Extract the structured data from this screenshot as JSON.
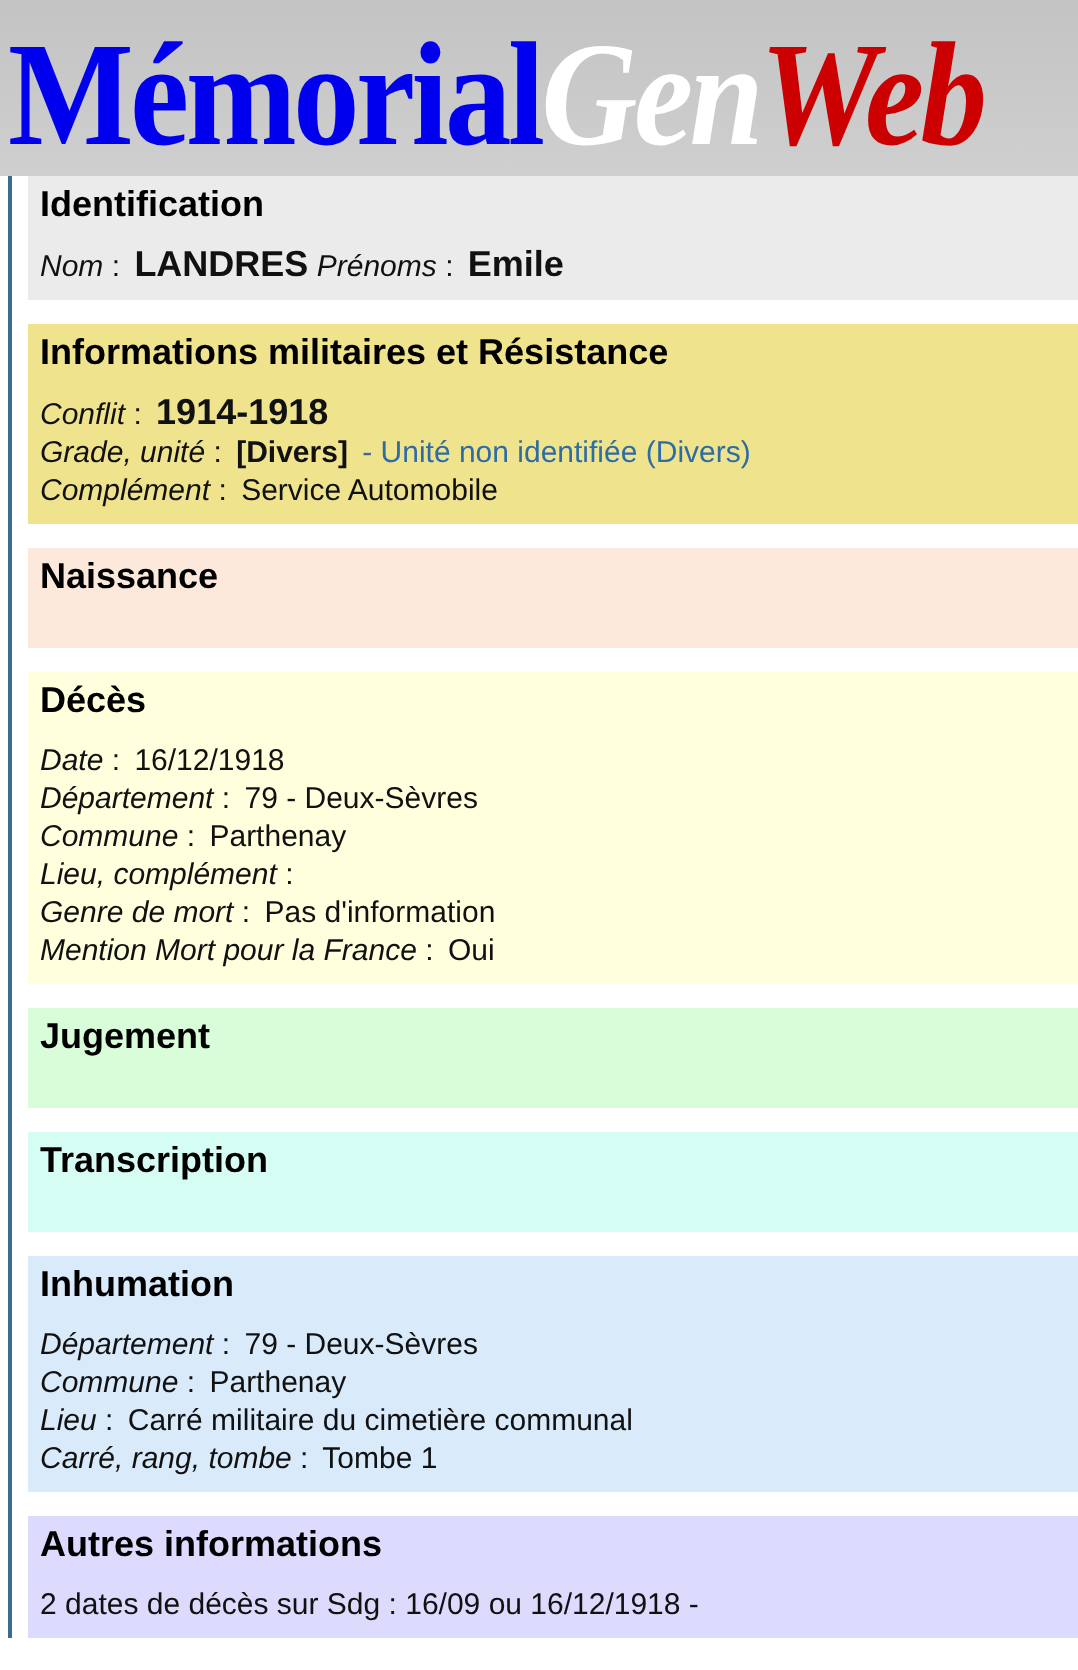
{
  "logo": {
    "parts": [
      {
        "text": "Mémorial",
        "kind": "main"
      },
      {
        "text": "Gen",
        "kind": "light"
      },
      {
        "text": "Web",
        "kind": "accent"
      }
    ]
  },
  "sections": [
    {
      "title": "Identification",
      "color": "#ebebeb",
      "lines": [
        {
          "pairs": [
            {
              "label": "*Nom* :",
              "value": "LANDRES",
              "kind": "large"
            },
            {
              "label": "*Prénoms* :",
              "value": "Emile",
              "kind": "large"
            }
          ]
        }
      ]
    },
    {
      "title": "Informations militaires et Résistance",
      "color": "#efe38d",
      "lines": [
        {
          "pairs": [
            {
              "label": "*Conflit* :",
              "value": "1914-1918",
              "kind": "large"
            }
          ]
        },
        {
          "pairs": [
            {
              "label": "*Grade, unité* :",
              "value": "[Divers]",
              "kind": "bold",
              "link": "- Unité non identifiée (Divers)"
            }
          ]
        },
        {
          "pairs": [
            {
              "label": "*Complément* :",
              "value": "Service Automobile",
              "kind": "plain"
            }
          ]
        }
      ]
    },
    {
      "title": "Naissance",
      "color": "#fde8dc"
    },
    {
      "title": "Décès",
      "color": "#ffffdd",
      "lines": [
        {
          "pairs": [
            {
              "label": "*Date* :",
              "value": "16/12/1918",
              "kind": "plain"
            }
          ]
        },
        {
          "pairs": [
            {
              "label": "*Département* :",
              "value": "79 - Deux-Sèvres",
              "kind": "plain"
            }
          ]
        },
        {
          "pairs": [
            {
              "label": "*Commune* :",
              "value": "Parthenay",
              "kind": "plain"
            }
          ]
        },
        {
          "pairs": [
            {
              "label": "*Lieu, complément* :"
            }
          ]
        },
        {
          "pairs": [
            {
              "label": "*Genre de mort* :",
              "value": "Pas d'information",
              "kind": "plain"
            }
          ]
        },
        {
          "pairs": [
            {
              "label": "*Mention Mort pour la France* :",
              "value": "Oui",
              "kind": "plain"
            }
          ]
        }
      ]
    },
    {
      "title": "Jugement",
      "color": "#d9fdd9"
    },
    {
      "title": "Transcription",
      "color": "#d6fdf4"
    },
    {
      "title": "Inhumation",
      "color": "#d9eafb",
      "lines": [
        {
          "pairs": [
            {
              "label": "*Département* :",
              "value": "79 - Deux-Sèvres",
              "kind": "plain"
            }
          ]
        },
        {
          "pairs": [
            {
              "label": "*Commune* :",
              "value": "Parthenay",
              "kind": "plain"
            }
          ]
        },
        {
          "pairs": [
            {
              "label": "*Lieu* :",
              "value": "Carré militaire du cimetière communal",
              "kind": "plain"
            }
          ]
        },
        {
          "pairs": [
            {
              "label": "*Carré, rang, tombe* :",
              "value": "Tombe 1",
              "kind": "plain"
            }
          ]
        }
      ]
    },
    {
      "title": "Autres informations",
      "color": "#dcdafd",
      "lines": [
        {
          "text": "2 dates de décès sur Sdg : 16/09 ou 16/12/1918 -"
        }
      ]
    }
  ]
}
